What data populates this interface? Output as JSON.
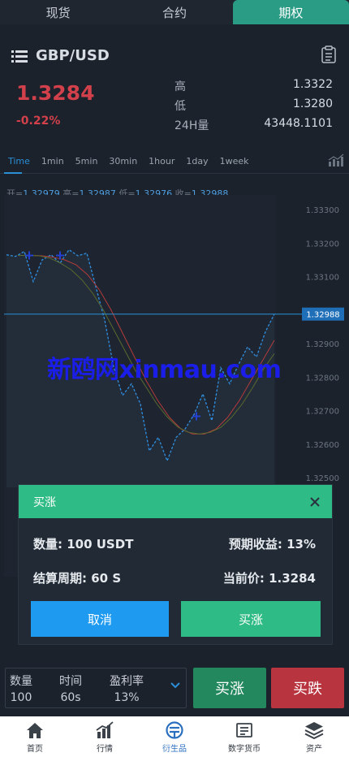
{
  "top_tabs": [
    {
      "label": "现货",
      "active": false
    },
    {
      "label": "合约",
      "active": false
    },
    {
      "label": "期权",
      "active": true
    }
  ],
  "pair": {
    "name": "GBP/USD",
    "menu_icon": "list-icon",
    "action_icon": "clipboard-icon"
  },
  "ticker": {
    "price": "1.3284",
    "change": "-0.22%",
    "high_label": "高",
    "high": "1.3322",
    "low_label": "低",
    "low": "1.3280",
    "volume_label": "24H量",
    "volume": "43448.1101"
  },
  "intervals": [
    "Time",
    "1min",
    "5min",
    "30min",
    "1hour",
    "1day",
    "1week"
  ],
  "active_interval": "Time",
  "ohlc": {
    "open_label": "开=",
    "open": "1.32979",
    "high_label": "高=",
    "high": "1.32987",
    "low_label": "低=",
    "low": "1.32976",
    "close_label": "收=",
    "close": "1.32988"
  },
  "chart_data": {
    "type": "line",
    "y_ticks": [
      "1.33300",
      "1.33200",
      "1.33100",
      "1.33000",
      "1.32900",
      "1.32800",
      "1.32700",
      "1.32600",
      "1.32500"
    ],
    "ylim": [
      1.325,
      1.333
    ],
    "current_price_label": "1.32988",
    "current_price": 1.32988,
    "series": [
      {
        "values": [
          1.33165,
          1.3316,
          1.33175,
          1.33085,
          1.3315,
          1.33165,
          1.3314,
          1.3318,
          1.33162,
          1.3317,
          1.3307,
          1.3297,
          1.3283,
          1.32745,
          1.3278,
          1.3272,
          1.3258,
          1.3262,
          1.3255,
          1.3262,
          1.32645,
          1.32688,
          1.3275,
          1.3267,
          1.32828,
          1.3278,
          1.32838,
          1.3289,
          1.3286,
          1.32935,
          1.32988
        ]
      },
      {
        "values": [
          1.33163,
          1.33163,
          1.33162,
          1.33158,
          1.3315,
          1.33135,
          1.33105,
          1.3306,
          1.33,
          1.3293,
          1.3286,
          1.3279,
          1.3273,
          1.3268,
          1.32645,
          1.3263,
          1.3263,
          1.32645,
          1.3268,
          1.3273,
          1.3279,
          1.3285,
          1.3291
        ]
      },
      {
        "values": [
          1.33163,
          1.33163,
          1.33162,
          1.33155,
          1.3314,
          1.3312,
          1.3309,
          1.3305,
          1.33,
          1.3294,
          1.3288,
          1.3282,
          1.3277,
          1.3272,
          1.3268,
          1.3265,
          1.32635,
          1.3263,
          1.32635,
          1.3265,
          1.3268,
          1.3272,
          1.3277,
          1.32825,
          1.3287
        ]
      }
    ]
  },
  "watermark": "新鸥网xinmau.com",
  "modal": {
    "title": "买涨",
    "amount_label": "数量: 100 USDT",
    "yield_label": "预期收益: 13%",
    "period_label": "结算周期: 60 S",
    "price_label": "当前价: 1.3284",
    "cancel": "取消",
    "confirm": "买涨"
  },
  "order": {
    "qty_label": "数量",
    "qty": "100",
    "time_label": "时间",
    "time": "60s",
    "rate_label": "盈利率",
    "rate": "13%",
    "buy_up": "买涨",
    "buy_down": "买跌"
  },
  "nav": [
    {
      "label": "首页",
      "icon": "home-icon",
      "active": false
    },
    {
      "label": "行情",
      "icon": "market-icon",
      "active": false
    },
    {
      "label": "衍生品",
      "icon": "derivatives-icon",
      "active": true
    },
    {
      "label": "数字货币",
      "icon": "crypto-icon",
      "active": false
    },
    {
      "label": "资产",
      "icon": "assets-icon",
      "active": false
    }
  ],
  "colors": {
    "accent": "#2fbb85",
    "down": "#d2414b",
    "blue": "#1e9bf0"
  }
}
